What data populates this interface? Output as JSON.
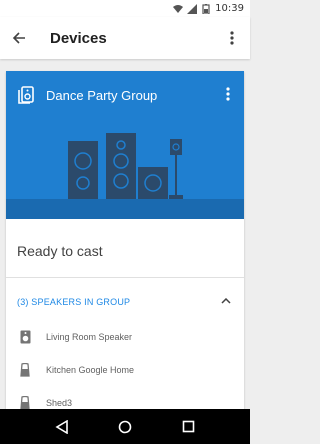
{
  "status_bar": {
    "time": "10:39",
    "icons": [
      "wifi-icon",
      "signal-icon",
      "battery-icon"
    ]
  },
  "app_bar": {
    "title": "Devices",
    "back_icon": "arrow-back-icon",
    "menu_icon": "more-vert-icon"
  },
  "group_card": {
    "title": "Dance Party Group",
    "icon": "speaker-group-icon",
    "menu_icon": "more-vert-icon",
    "header_color": "#1f7fd0",
    "status": "Ready to cast",
    "section_header": "(3) SPEAKERS IN GROUP",
    "collapse_icon": "chevron-up-icon",
    "speakers": [
      {
        "name": "Living Room Speaker",
        "icon": "speaker-icon"
      },
      {
        "name": "Kitchen Google Home",
        "icon": "google-home-icon"
      },
      {
        "name": "Shed3",
        "icon": "google-home-icon"
      }
    ]
  },
  "nav_bar": {
    "icons": [
      "back-triangle-icon",
      "home-circle-icon",
      "recents-square-icon"
    ]
  },
  "colors": {
    "accent": "#1e88e5",
    "header_blue": "#1f7fd0",
    "art_dark": "#2b4a6b"
  }
}
